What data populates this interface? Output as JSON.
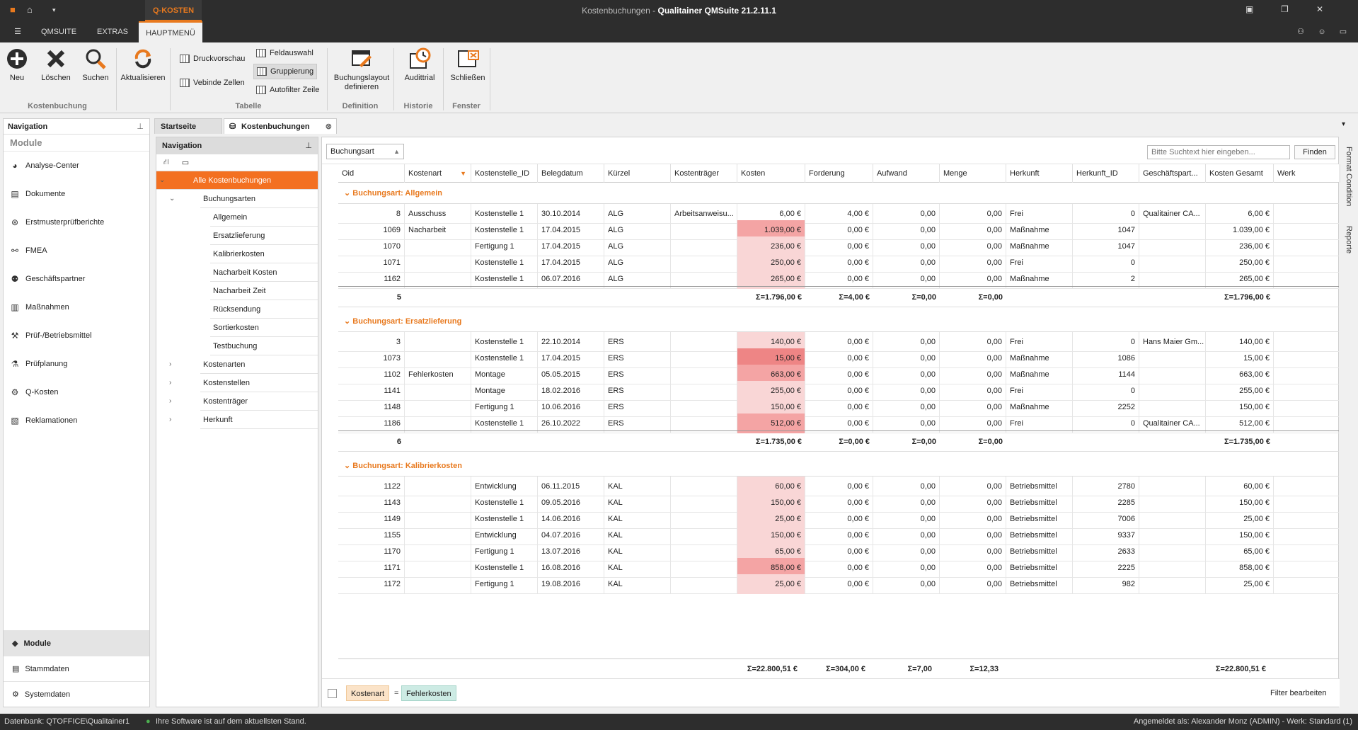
{
  "titlebar": {
    "context": "Q-KOSTEN",
    "title_prefix": "Kostenbuchungen - ",
    "title_app": "Qualitainer QMSuite 21.2.11.1"
  },
  "menu_tabs": [
    "QMSUITE",
    "EXTRAS",
    "HAUPTMENÜ"
  ],
  "ribbon": {
    "neu": "Neu",
    "loeschen": "Löschen",
    "suchen": "Suchen",
    "aktualisieren": "Aktualisieren",
    "druckvorschau": "Druckvorschau",
    "verbinde": "Vebinde Zellen",
    "feldauswahl": "Feldauswahl",
    "gruppierung": "Gruppierung",
    "autofilter": "Autofilter Zeile",
    "layout1": "Buchungslayout",
    "layout2": "definieren",
    "audittrail": "Audittrial",
    "schliessen": "Schließen",
    "groups": {
      "kostenbuchung": "Kostenbuchung",
      "tabelle": "Tabelle",
      "definition": "Definition",
      "historie": "Historie",
      "fenster": "Fenster"
    }
  },
  "nav": {
    "title": "Navigation",
    "module_header": "Module",
    "items": [
      "Analyse-Center",
      "Dokumente",
      "Erstmusterprüfberichte",
      "FMEA",
      "Geschäftspartner",
      "Maßnahmen",
      "Prüf-/Betriebsmittel",
      "Prüfplanung",
      "Q-Kosten",
      "Reklamationen"
    ],
    "bottom": [
      "Module",
      "Stammdaten",
      "Systemdaten"
    ]
  },
  "doctabs": {
    "start": "Startseite",
    "kosten": "Kostenbuchungen"
  },
  "subnav": {
    "title": "Navigation",
    "root": "Alle Kostenbuchungen",
    "buchungsarten": "Buchungsarten",
    "arten": [
      "Allgemein",
      "Ersatzlieferung",
      "Kalibrierkosten",
      "Nacharbeit Kosten",
      "Nacharbeit Zeit",
      "Rücksendung",
      "Sortierkosten",
      "Testbuchung"
    ],
    "others": [
      "Kostenarten",
      "Kostenstellen",
      "Kostenträger",
      "Herkunft"
    ]
  },
  "grid": {
    "group_by": "Buchungsart",
    "search_placeholder": "Bitte Suchtext hier eingeben...",
    "find": "Finden",
    "columns": [
      "Oid",
      "Kostenart",
      "Kostenstelle_ID",
      "Belegdatum",
      "Kürzel",
      "Kostenträger",
      "Kosten",
      "Forderung",
      "Aufwand",
      "Menge",
      "Herkunft",
      "Herkunft_ID",
      "Geschäftspart...",
      "Kosten Gesamt",
      "Werk"
    ],
    "groups": [
      {
        "label": "Buchungsart: Allgemein",
        "rows": [
          [
            "8",
            "Ausschuss",
            "Kostenstelle 1",
            "30.10.2014",
            "ALG",
            "Arbeitsanweisu...",
            "6,00 €",
            "4,00 €",
            "0,00",
            "0,00",
            "Frei",
            "0",
            "Qualitainer CA...",
            "6,00 €"
          ],
          [
            "1069",
            "Nacharbeit",
            "Kostenstelle 1",
            "17.04.2015",
            "ALG",
            "",
            "1.039,00 €",
            "0,00 €",
            "0,00",
            "0,00",
            "Maßnahme",
            "1047",
            "",
            "1.039,00 €"
          ],
          [
            "1070",
            "",
            "Fertigung 1",
            "17.04.2015",
            "ALG",
            "",
            "236,00 €",
            "0,00 €",
            "0,00",
            "0,00",
            "Maßnahme",
            "1047",
            "",
            "236,00 €"
          ],
          [
            "1071",
            "",
            "Kostenstelle 1",
            "17.04.2015",
            "ALG",
            "",
            "250,00 €",
            "0,00 €",
            "0,00",
            "0,00",
            "Frei",
            "0",
            "",
            "250,00 €"
          ],
          [
            "1162",
            "",
            "Kostenstelle 1",
            "06.07.2016",
            "ALG",
            "",
            "265,00 €",
            "0,00 €",
            "0,00",
            "0,00",
            "Maßnahme",
            "2",
            "",
            "265,00 €"
          ]
        ],
        "heat": [
          0,
          2,
          1,
          1,
          1
        ],
        "sum": {
          "count": "5",
          "kosten": "Σ=1.796,00 €",
          "forderung": "Σ=4,00 €",
          "aufwand": "Σ=0,00",
          "menge": "Σ=0,00",
          "gesamt": "Σ=1.796,00 €"
        }
      },
      {
        "label": "Buchungsart: Ersatzlieferung",
        "rows": [
          [
            "3",
            "",
            "Kostenstelle 1",
            "22.10.2014",
            "ERS",
            "",
            "140,00 €",
            "0,00 €",
            "0,00",
            "0,00",
            "Frei",
            "0",
            "Hans Maier Gm...",
            "140,00 €"
          ],
          [
            "1073",
            "",
            "Kostenstelle 1",
            "17.04.2015",
            "ERS",
            "",
            "15,00 €",
            "0,00 €",
            "0,00",
            "0,00",
            "Maßnahme",
            "1086",
            "",
            "15,00 €"
          ],
          [
            "1102",
            "Fehlerkosten",
            "Montage",
            "05.05.2015",
            "ERS",
            "",
            "663,00 €",
            "0,00 €",
            "0,00",
            "0,00",
            "Maßnahme",
            "1144",
            "",
            "663,00 €"
          ],
          [
            "1141",
            "",
            "Montage",
            "18.02.2016",
            "ERS",
            "",
            "255,00 €",
            "0,00 €",
            "0,00",
            "0,00",
            "Frei",
            "0",
            "",
            "255,00 €"
          ],
          [
            "1148",
            "",
            "Fertigung 1",
            "10.06.2016",
            "ERS",
            "",
            "150,00 €",
            "0,00 €",
            "0,00",
            "0,00",
            "Maßnahme",
            "2252",
            "",
            "150,00 €"
          ],
          [
            "1186",
            "",
            "Kostenstelle 1",
            "26.10.2022",
            "ERS",
            "",
            "512,00 €",
            "0,00 €",
            "0,00",
            "0,00",
            "Frei",
            "0",
            "Qualitainer CA...",
            "512,00 €"
          ]
        ],
        "heat": [
          1,
          3,
          2,
          1,
          1,
          2
        ],
        "sum": {
          "count": "6",
          "kosten": "Σ=1.735,00 €",
          "forderung": "Σ=0,00 €",
          "aufwand": "Σ=0,00",
          "menge": "Σ=0,00",
          "gesamt": "Σ=1.735,00 €"
        }
      },
      {
        "label": "Buchungsart: Kalibrierkosten",
        "rows": [
          [
            "1122",
            "",
            "Entwicklung",
            "06.11.2015",
            "KAL",
            "",
            "60,00 €",
            "0,00 €",
            "0,00",
            "0,00",
            "Betriebsmittel",
            "2780",
            "",
            "60,00 €"
          ],
          [
            "1143",
            "",
            "Kostenstelle 1",
            "09.05.2016",
            "KAL",
            "",
            "150,00 €",
            "0,00 €",
            "0,00",
            "0,00",
            "Betriebsmittel",
            "2285",
            "",
            "150,00 €"
          ],
          [
            "1149",
            "",
            "Kostenstelle 1",
            "14.06.2016",
            "KAL",
            "",
            "25,00 €",
            "0,00 €",
            "0,00",
            "0,00",
            "Betriebsmittel",
            "7006",
            "",
            "25,00 €"
          ],
          [
            "1155",
            "",
            "Entwicklung",
            "04.07.2016",
            "KAL",
            "",
            "150,00 €",
            "0,00 €",
            "0,00",
            "0,00",
            "Betriebsmittel",
            "9337",
            "",
            "150,00 €"
          ],
          [
            "1170",
            "",
            "Fertigung 1",
            "13.07.2016",
            "KAL",
            "",
            "65,00 €",
            "0,00 €",
            "0,00",
            "0,00",
            "Betriebsmittel",
            "2633",
            "",
            "65,00 €"
          ],
          [
            "1171",
            "",
            "Kostenstelle 1",
            "16.08.2016",
            "KAL",
            "",
            "858,00 €",
            "0,00 €",
            "0,00",
            "0,00",
            "Betriebsmittel",
            "2225",
            "",
            "858,00 €"
          ],
          [
            "1172",
            "",
            "Fertigung 1",
            "19.08.2016",
            "KAL",
            "",
            "25,00 €",
            "0,00 €",
            "0,00",
            "0,00",
            "Betriebsmittel",
            "982",
            "",
            "25,00 €"
          ]
        ],
        "heat": [
          1,
          1,
          1,
          1,
          1,
          2,
          1
        ]
      }
    ],
    "total": {
      "kosten": "Σ=22.800,51 €",
      "forderung": "Σ=304,00 €",
      "aufwand": "Σ=7,00",
      "menge": "Σ=12,33",
      "gesamt": "Σ=22.800,51 €"
    },
    "filter": {
      "field": "Kostenart",
      "op": "=",
      "value": "Fehlerkosten",
      "edit": "Filter bearbeiten"
    }
  },
  "side_strip": [
    "Format Condition",
    "Reporte"
  ],
  "status": {
    "db": "Datenbank:  QTOFFICE\\Qualitainer1",
    "update": "Ihre Software ist auf dem aktuellsten Stand.",
    "user": "Angemeldet als: Alexander Monz (ADMIN) - Werk: Standard (1)"
  },
  "colors": {
    "accent": "#e8791e",
    "heat1": "#f9d6d6",
    "heat2": "#f4a4a4",
    "heat3": "#ee8585"
  }
}
